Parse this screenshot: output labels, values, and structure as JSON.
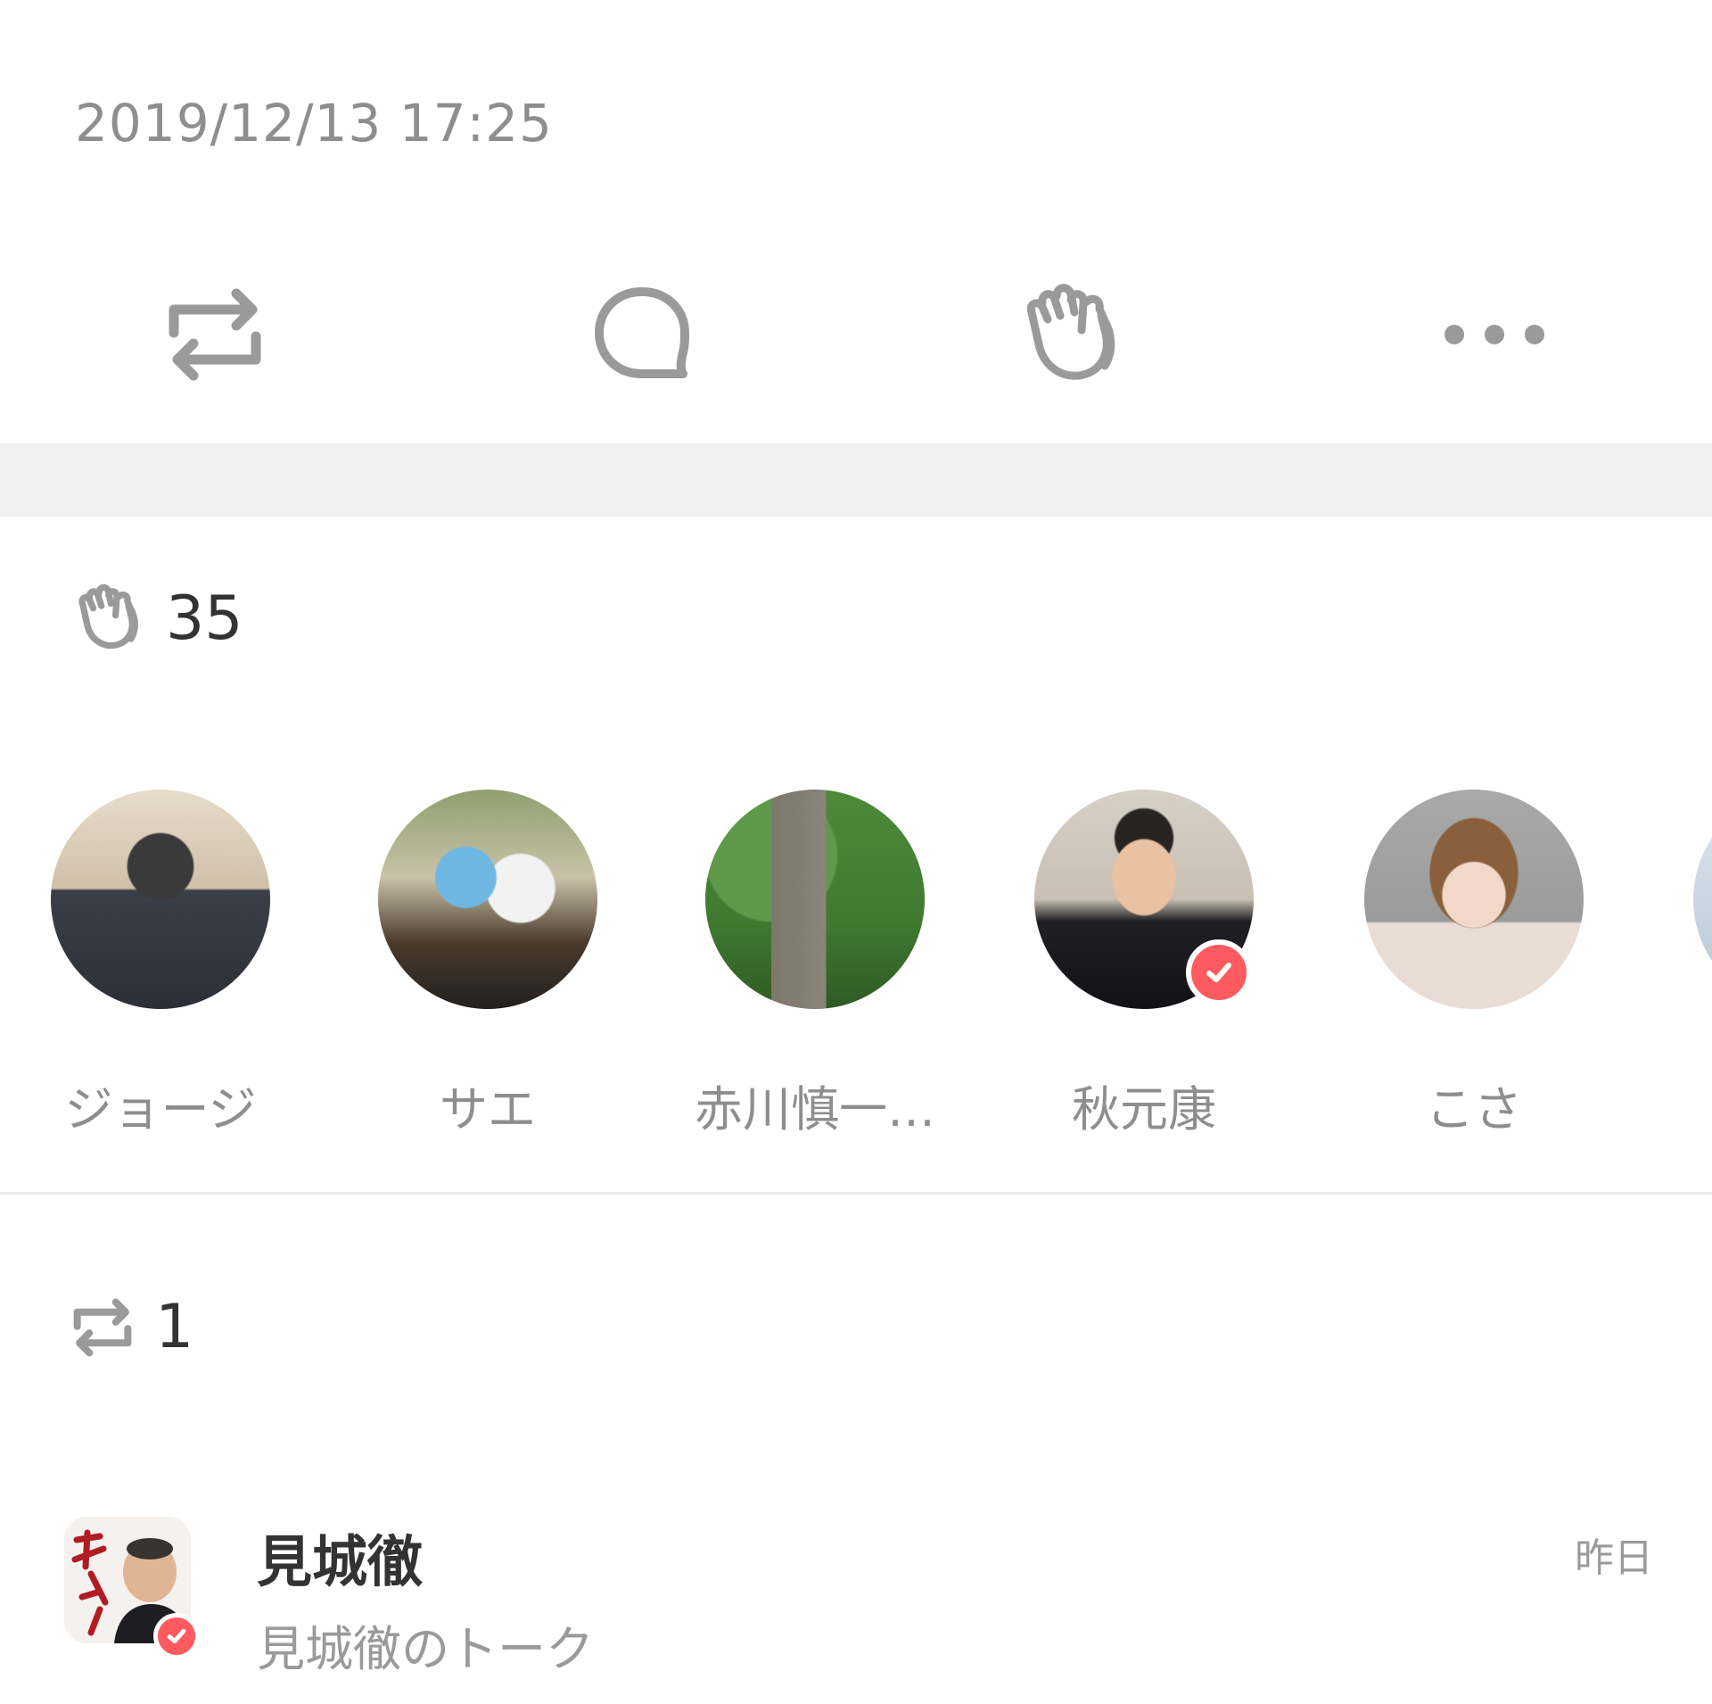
{
  "post": {
    "timestamp": "2019/12/13 17:25"
  },
  "actions": [
    {
      "name": "repost",
      "icon": "repost-icon"
    },
    {
      "name": "comment",
      "icon": "comment-icon"
    },
    {
      "name": "clap",
      "icon": "clap-icon"
    },
    {
      "name": "more",
      "icon": "more-icon"
    }
  ],
  "claps": {
    "icon": "clap-icon",
    "count": "35",
    "users": [
      {
        "name": "ジョージ",
        "verified": false
      },
      {
        "name": "サエ",
        "verified": false
      },
      {
        "name": "赤川慎一…",
        "verified": false
      },
      {
        "name": "秋元康",
        "verified": true
      },
      {
        "name": "こさ",
        "verified": false
      }
    ]
  },
  "reposts": {
    "icon": "repost-icon",
    "count": "1",
    "items": [
      {
        "name": "見城徹",
        "subtitle": "見城徹のトーク",
        "time": "昨日",
        "verified": true
      }
    ]
  },
  "colors": {
    "icon_gray": "#9a9a9a",
    "text_gray": "#8e8e8e",
    "band": "#f0f0f0",
    "badge_red": "#ff5a5f"
  }
}
